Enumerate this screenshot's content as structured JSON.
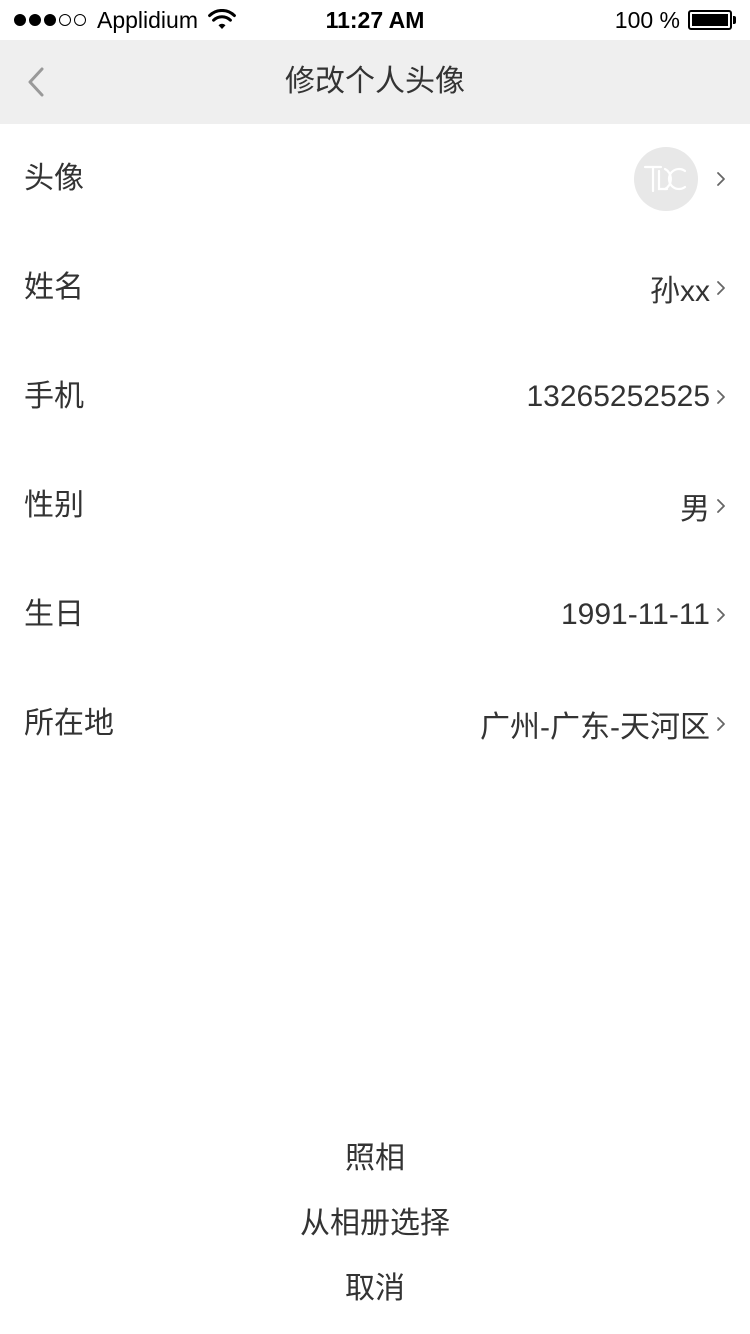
{
  "status_bar": {
    "carrier": "Applidium",
    "time": "11:27 AM",
    "battery": "100 %",
    "battery_level": 1.0,
    "signal_filled": 3,
    "signal_total": 5,
    "wifi_icon": "wifi-icon"
  },
  "nav": {
    "title": "修改个人头像",
    "back_icon": "chevron-left-icon"
  },
  "profile": {
    "avatar_label": "头像",
    "avatar_icon": "avatar-logo-icon",
    "rows": [
      {
        "label": "姓名",
        "value": "孙xx"
      },
      {
        "label": "手机",
        "value": "13265252525"
      },
      {
        "label": "性别",
        "value": "男"
      },
      {
        "label": "生日",
        "value": "1991-11-11"
      },
      {
        "label": "所在地",
        "value": "广州-广东-天河区"
      }
    ]
  },
  "action_sheet": {
    "items": [
      "照相",
      "从相册选择",
      "取消"
    ]
  },
  "colors": {
    "nav_background": "#efefef",
    "text": "#333333",
    "chevron": "#999999",
    "avatar_background": "#e8e8e8"
  }
}
